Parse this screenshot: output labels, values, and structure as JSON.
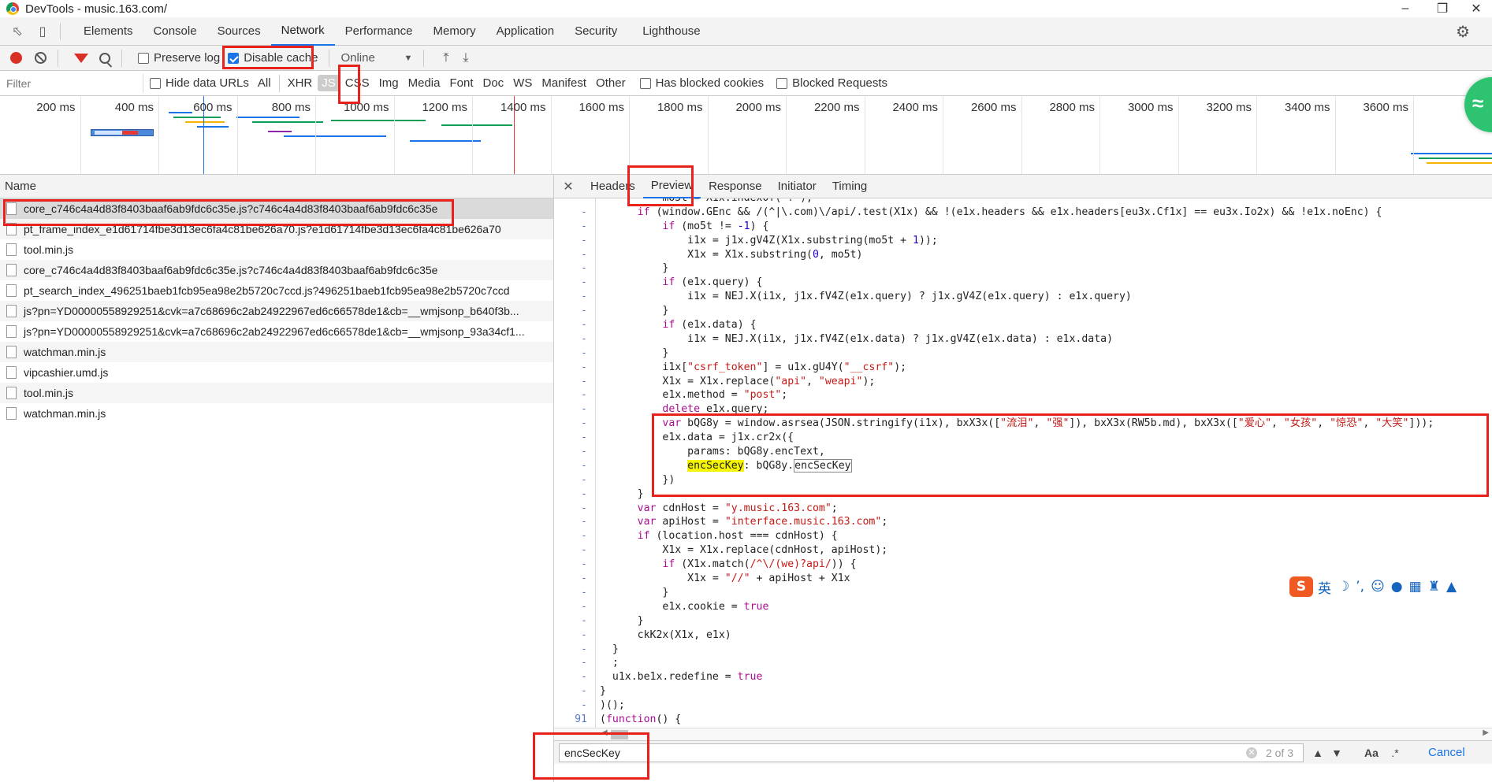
{
  "window": {
    "title": "DevTools - music.163.com/"
  },
  "tabs": [
    "Elements",
    "Console",
    "Sources",
    "Network",
    "Performance",
    "Memory",
    "Application",
    "Security",
    "Lighthouse"
  ],
  "active_tab": "Network",
  "toolbar": {
    "preserve_log": "Preserve log",
    "disable_cache": "Disable cache",
    "throttle": "Online"
  },
  "filterbar": {
    "placeholder": "Filter",
    "hide_data_urls": "Hide data URLs",
    "types": [
      "All",
      "XHR",
      "JS",
      "CSS",
      "Img",
      "Media",
      "Font",
      "Doc",
      "WS",
      "Manifest",
      "Other"
    ],
    "selected_type": "JS",
    "has_blocked_cookies": "Has blocked cookies",
    "blocked_requests": "Blocked Requests"
  },
  "timeline": {
    "ticks": [
      "200 ms",
      "400 ms",
      "600 ms",
      "800 ms",
      "1000 ms",
      "1200 ms",
      "1400 ms",
      "1600 ms",
      "1800 ms",
      "2000 ms",
      "2200 ms",
      "2400 ms",
      "2600 ms",
      "2800 ms",
      "3000 ms",
      "3200 ms",
      "3400 ms",
      "3600 ms",
      "38"
    ]
  },
  "requests": {
    "header": "Name",
    "rows": [
      "core_c746c4a4d83f8403baaf6ab9fdc6c35e.js?c746c4a4d83f8403baaf6ab9fdc6c35e",
      "pt_frame_index_e1d61714fbe3d13ec6fa4c81be626a70.js?e1d61714fbe3d13ec6fa4c81be626a70",
      "tool.min.js",
      "core_c746c4a4d83f8403baaf6ab9fdc6c35e.js?c746c4a4d83f8403baaf6ab9fdc6c35e",
      "pt_search_index_496251baeb1fcb95ea98e2b5720c7ccd.js?496251baeb1fcb95ea98e2b5720c7ccd",
      "js?pn=YD00000558929251&cvk=a7c68696c2ab24922967ed6c66578de1&cb=__wmjsonp_b640f3b...",
      "js?pn=YD00000558929251&cvk=a7c68696c2ab24922967ed6c66578de1&cb=__wmjsonp_93a34cf1...",
      "watchman.min.js",
      "vipcashier.umd.js",
      "tool.min.js",
      "watchman.min.js"
    ]
  },
  "detail_tabs": [
    "Headers",
    "Preview",
    "Response",
    "Initiator",
    "Timing"
  ],
  "active_detail_tab": "Preview",
  "code": {
    "gutter": [
      "-",
      "-",
      "-",
      "-",
      "-",
      "-",
      "-",
      "-",
      "-",
      "-",
      "-",
      "-",
      "-",
      "-",
      "-",
      "-",
      "-",
      "-",
      "-",
      "-",
      "-",
      "-",
      "-",
      "-",
      "-",
      "-",
      "-",
      "-",
      "-",
      "-",
      "-",
      "-",
      "-",
      "-",
      "-",
      "-",
      "-",
      "91"
    ]
  },
  "search": {
    "query": "encSecKey",
    "count": "2 of 3",
    "case_label": "Aa",
    "regex_label": ".*",
    "cancel": "Cancel"
  },
  "ime": {
    "logo": "S",
    "lang": "英"
  }
}
